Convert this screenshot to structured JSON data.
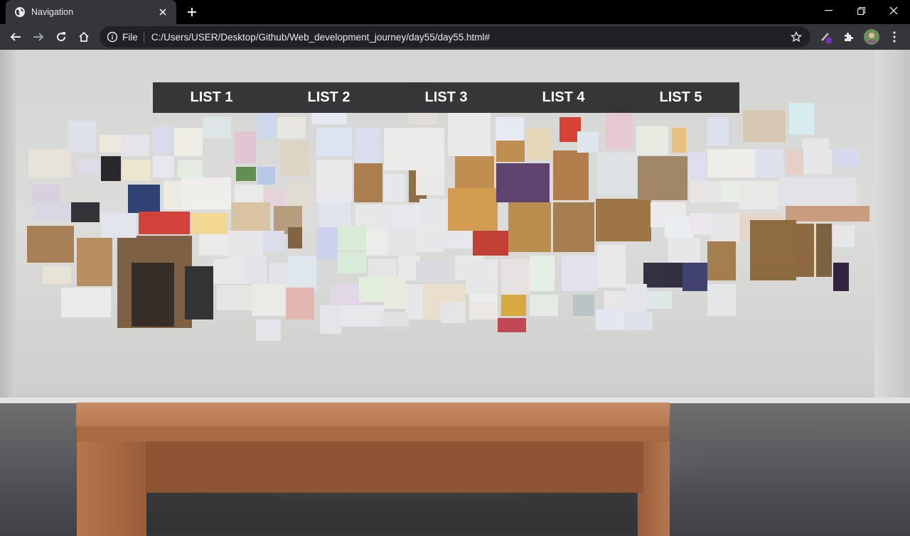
{
  "browser": {
    "tab": {
      "title": "Navigation"
    },
    "address": {
      "scheme_label": "File",
      "url": "C:/Users/USER/Desktop/Github/Web_development_journey/day55/day55.html#"
    },
    "icons": {
      "favicon": "globe-icon",
      "tab_close": "close-icon",
      "new_tab": "plus-icon",
      "back": "arrow-left-icon",
      "forward": "arrow-right-icon",
      "reload": "reload-icon",
      "home": "home-icon",
      "info": "info-icon",
      "bookmark": "star-icon",
      "extension_pen": "pen-extension-icon",
      "extensions": "puzzle-icon",
      "profile": "avatar-icon",
      "menu": "kebab-menu-icon",
      "minimize": "minimize-icon",
      "restore": "restore-icon",
      "close_window": "close-icon"
    },
    "colors": {
      "tabstrip": "#000000",
      "toolbar": "#35363a",
      "omnibox": "#202124"
    }
  },
  "page": {
    "background_scene": "gallery-wall-with-bench-photo",
    "nav": {
      "items": [
        {
          "label": "LIST 1"
        },
        {
          "label": "LIST 2"
        },
        {
          "label": "LIST 3"
        },
        {
          "label": "LIST 4"
        },
        {
          "label": "LIST 5"
        }
      ],
      "colors": {
        "bar": "#28282b",
        "text": "#ffffff"
      }
    }
  }
}
